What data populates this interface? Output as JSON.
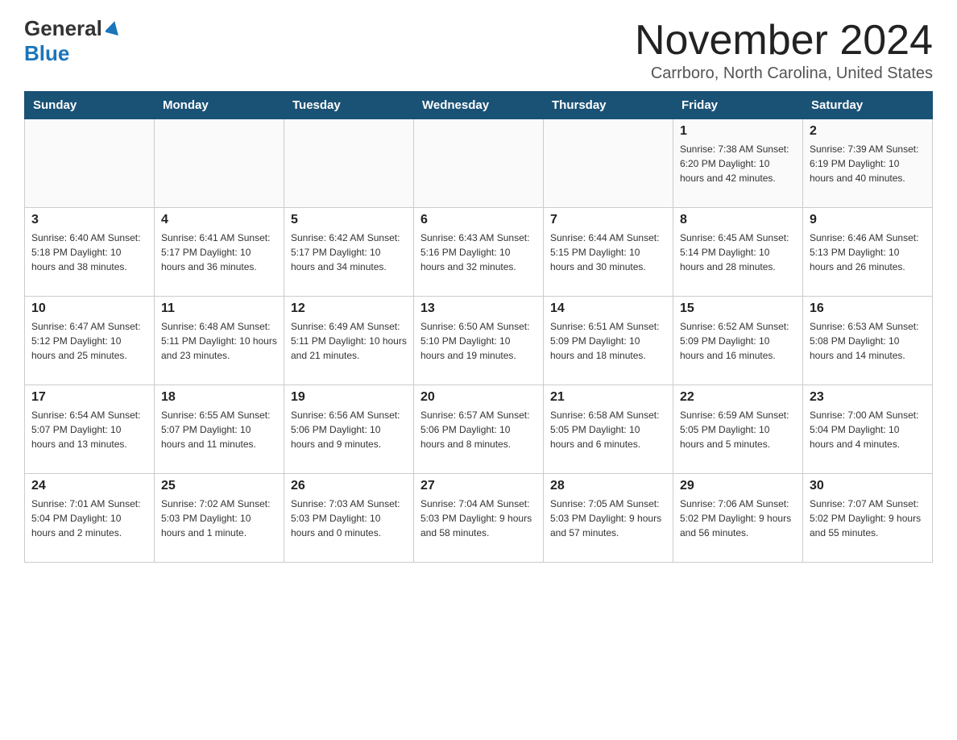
{
  "logo": {
    "line1": "General",
    "line2": "Blue"
  },
  "header": {
    "month": "November 2024",
    "location": "Carrboro, North Carolina, United States"
  },
  "days_of_week": [
    "Sunday",
    "Monday",
    "Tuesday",
    "Wednesday",
    "Thursday",
    "Friday",
    "Saturday"
  ],
  "weeks": [
    [
      {
        "day": "",
        "info": ""
      },
      {
        "day": "",
        "info": ""
      },
      {
        "day": "",
        "info": ""
      },
      {
        "day": "",
        "info": ""
      },
      {
        "day": "",
        "info": ""
      },
      {
        "day": "1",
        "info": "Sunrise: 7:38 AM\nSunset: 6:20 PM\nDaylight: 10 hours and 42 minutes."
      },
      {
        "day": "2",
        "info": "Sunrise: 7:39 AM\nSunset: 6:19 PM\nDaylight: 10 hours and 40 minutes."
      }
    ],
    [
      {
        "day": "3",
        "info": "Sunrise: 6:40 AM\nSunset: 5:18 PM\nDaylight: 10 hours and 38 minutes."
      },
      {
        "day": "4",
        "info": "Sunrise: 6:41 AM\nSunset: 5:17 PM\nDaylight: 10 hours and 36 minutes."
      },
      {
        "day": "5",
        "info": "Sunrise: 6:42 AM\nSunset: 5:17 PM\nDaylight: 10 hours and 34 minutes."
      },
      {
        "day": "6",
        "info": "Sunrise: 6:43 AM\nSunset: 5:16 PM\nDaylight: 10 hours and 32 minutes."
      },
      {
        "day": "7",
        "info": "Sunrise: 6:44 AM\nSunset: 5:15 PM\nDaylight: 10 hours and 30 minutes."
      },
      {
        "day": "8",
        "info": "Sunrise: 6:45 AM\nSunset: 5:14 PM\nDaylight: 10 hours and 28 minutes."
      },
      {
        "day": "9",
        "info": "Sunrise: 6:46 AM\nSunset: 5:13 PM\nDaylight: 10 hours and 26 minutes."
      }
    ],
    [
      {
        "day": "10",
        "info": "Sunrise: 6:47 AM\nSunset: 5:12 PM\nDaylight: 10 hours and 25 minutes."
      },
      {
        "day": "11",
        "info": "Sunrise: 6:48 AM\nSunset: 5:11 PM\nDaylight: 10 hours and 23 minutes."
      },
      {
        "day": "12",
        "info": "Sunrise: 6:49 AM\nSunset: 5:11 PM\nDaylight: 10 hours and 21 minutes."
      },
      {
        "day": "13",
        "info": "Sunrise: 6:50 AM\nSunset: 5:10 PM\nDaylight: 10 hours and 19 minutes."
      },
      {
        "day": "14",
        "info": "Sunrise: 6:51 AM\nSunset: 5:09 PM\nDaylight: 10 hours and 18 minutes."
      },
      {
        "day": "15",
        "info": "Sunrise: 6:52 AM\nSunset: 5:09 PM\nDaylight: 10 hours and 16 minutes."
      },
      {
        "day": "16",
        "info": "Sunrise: 6:53 AM\nSunset: 5:08 PM\nDaylight: 10 hours and 14 minutes."
      }
    ],
    [
      {
        "day": "17",
        "info": "Sunrise: 6:54 AM\nSunset: 5:07 PM\nDaylight: 10 hours and 13 minutes."
      },
      {
        "day": "18",
        "info": "Sunrise: 6:55 AM\nSunset: 5:07 PM\nDaylight: 10 hours and 11 minutes."
      },
      {
        "day": "19",
        "info": "Sunrise: 6:56 AM\nSunset: 5:06 PM\nDaylight: 10 hours and 9 minutes."
      },
      {
        "day": "20",
        "info": "Sunrise: 6:57 AM\nSunset: 5:06 PM\nDaylight: 10 hours and 8 minutes."
      },
      {
        "day": "21",
        "info": "Sunrise: 6:58 AM\nSunset: 5:05 PM\nDaylight: 10 hours and 6 minutes."
      },
      {
        "day": "22",
        "info": "Sunrise: 6:59 AM\nSunset: 5:05 PM\nDaylight: 10 hours and 5 minutes."
      },
      {
        "day": "23",
        "info": "Sunrise: 7:00 AM\nSunset: 5:04 PM\nDaylight: 10 hours and 4 minutes."
      }
    ],
    [
      {
        "day": "24",
        "info": "Sunrise: 7:01 AM\nSunset: 5:04 PM\nDaylight: 10 hours and 2 minutes."
      },
      {
        "day": "25",
        "info": "Sunrise: 7:02 AM\nSunset: 5:03 PM\nDaylight: 10 hours and 1 minute."
      },
      {
        "day": "26",
        "info": "Sunrise: 7:03 AM\nSunset: 5:03 PM\nDaylight: 10 hours and 0 minutes."
      },
      {
        "day": "27",
        "info": "Sunrise: 7:04 AM\nSunset: 5:03 PM\nDaylight: 9 hours and 58 minutes."
      },
      {
        "day": "28",
        "info": "Sunrise: 7:05 AM\nSunset: 5:03 PM\nDaylight: 9 hours and 57 minutes."
      },
      {
        "day": "29",
        "info": "Sunrise: 7:06 AM\nSunset: 5:02 PM\nDaylight: 9 hours and 56 minutes."
      },
      {
        "day": "30",
        "info": "Sunrise: 7:07 AM\nSunset: 5:02 PM\nDaylight: 9 hours and 55 minutes."
      }
    ]
  ]
}
